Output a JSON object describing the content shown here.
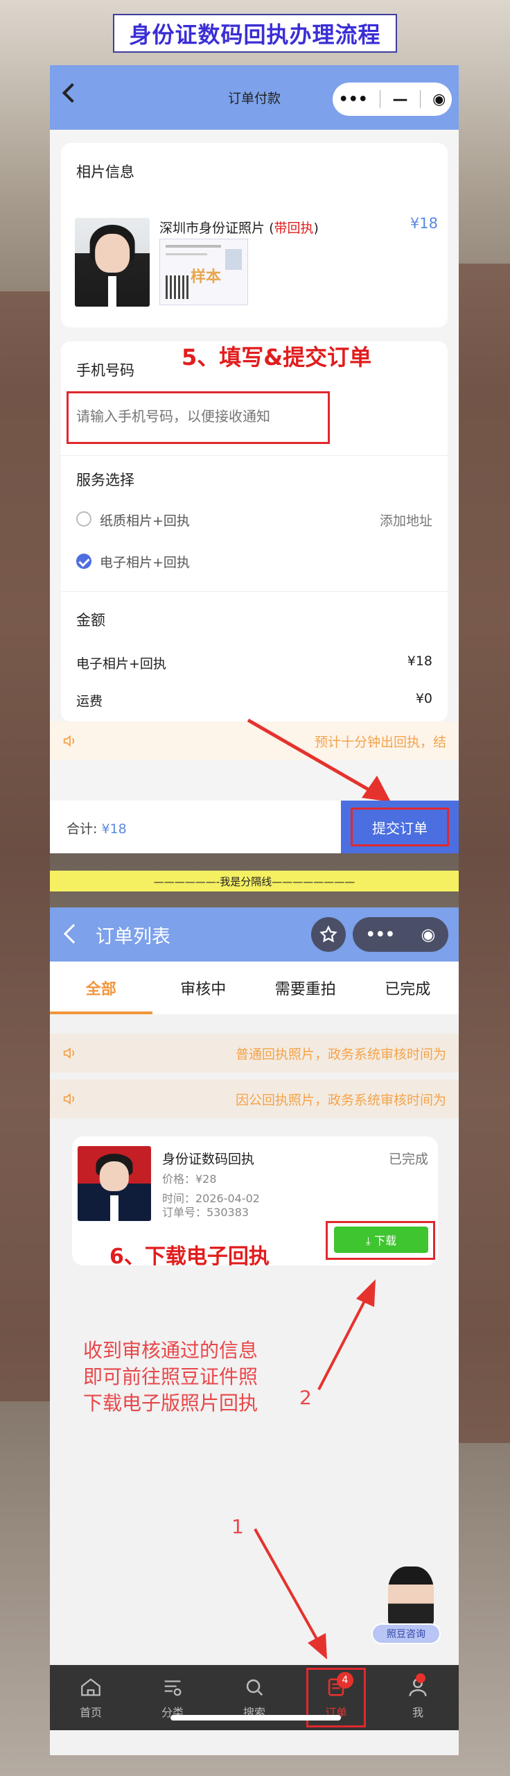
{
  "header": {
    "title": "身份证数码回执办理流程"
  },
  "order_pay": {
    "nav_title": "订单付款",
    "photo_section": {
      "title": "相片信息",
      "product_name": "深圳市身份证照片",
      "receipt_tag_open": "(",
      "receipt_tag": "带回执",
      "receipt_tag_close": ")",
      "price": "¥18",
      "stamp": "样本"
    },
    "phone_section": {
      "title": "手机号码",
      "placeholder": "请输入手机号码，以便接收通知"
    },
    "service_section": {
      "title": "服务选择",
      "options": [
        {
          "label": "纸质相片+回执",
          "action": "添加地址",
          "selected": false
        },
        {
          "label": "电子相片+回执",
          "selected": true
        }
      ]
    },
    "amount_section": {
      "title": "金额",
      "rows": [
        {
          "label": "电子相片+回执",
          "value": "¥18"
        },
        {
          "label": "运费",
          "value": "¥0"
        }
      ]
    },
    "notice": "预计十分钟出回执，结",
    "total_label": "合计:",
    "total_value": "¥18",
    "submit_label": "提交订单",
    "annotation": "5、填写&提交订单"
  },
  "divider": "——————-我是分隔线————————",
  "order_list": {
    "nav_title": "订单列表",
    "tabs": [
      "全部",
      "审核中",
      "需要重拍",
      "已完成"
    ],
    "notices": [
      "普通回执照片，政务系统审核时间为",
      "因公回执照片，政务系统审核时间为"
    ],
    "order": {
      "name": "身份证数码回执",
      "price": "价格：¥28",
      "time": "时间：2026-04-02",
      "order_no": "订单号：530383",
      "status": "已完成",
      "download_label": "⤓ 下载"
    },
    "annotation": "6、下载电子回执",
    "handnote": [
      "收到审核通过的信息",
      "即可前往照豆证件照",
      "下载电子版照片回执"
    ],
    "step2": "2",
    "step1": "1",
    "consult_label": "照豆咨询",
    "tabbar": [
      {
        "label": "首页",
        "icon": "home-icon"
      },
      {
        "label": "分类",
        "icon": "category-icon"
      },
      {
        "label": "搜索",
        "icon": "search-icon"
      },
      {
        "label": "订单",
        "icon": "order-icon",
        "badge": "4"
      },
      {
        "label": "我",
        "icon": "user-icon"
      }
    ]
  },
  "colors": {
    "nav_blue": "#7da1ea",
    "submit_blue": "#4b6fe0",
    "annotation_red": "#e11d1d",
    "tab_orange": "#f2953b",
    "download_green": "#3fc52f"
  }
}
